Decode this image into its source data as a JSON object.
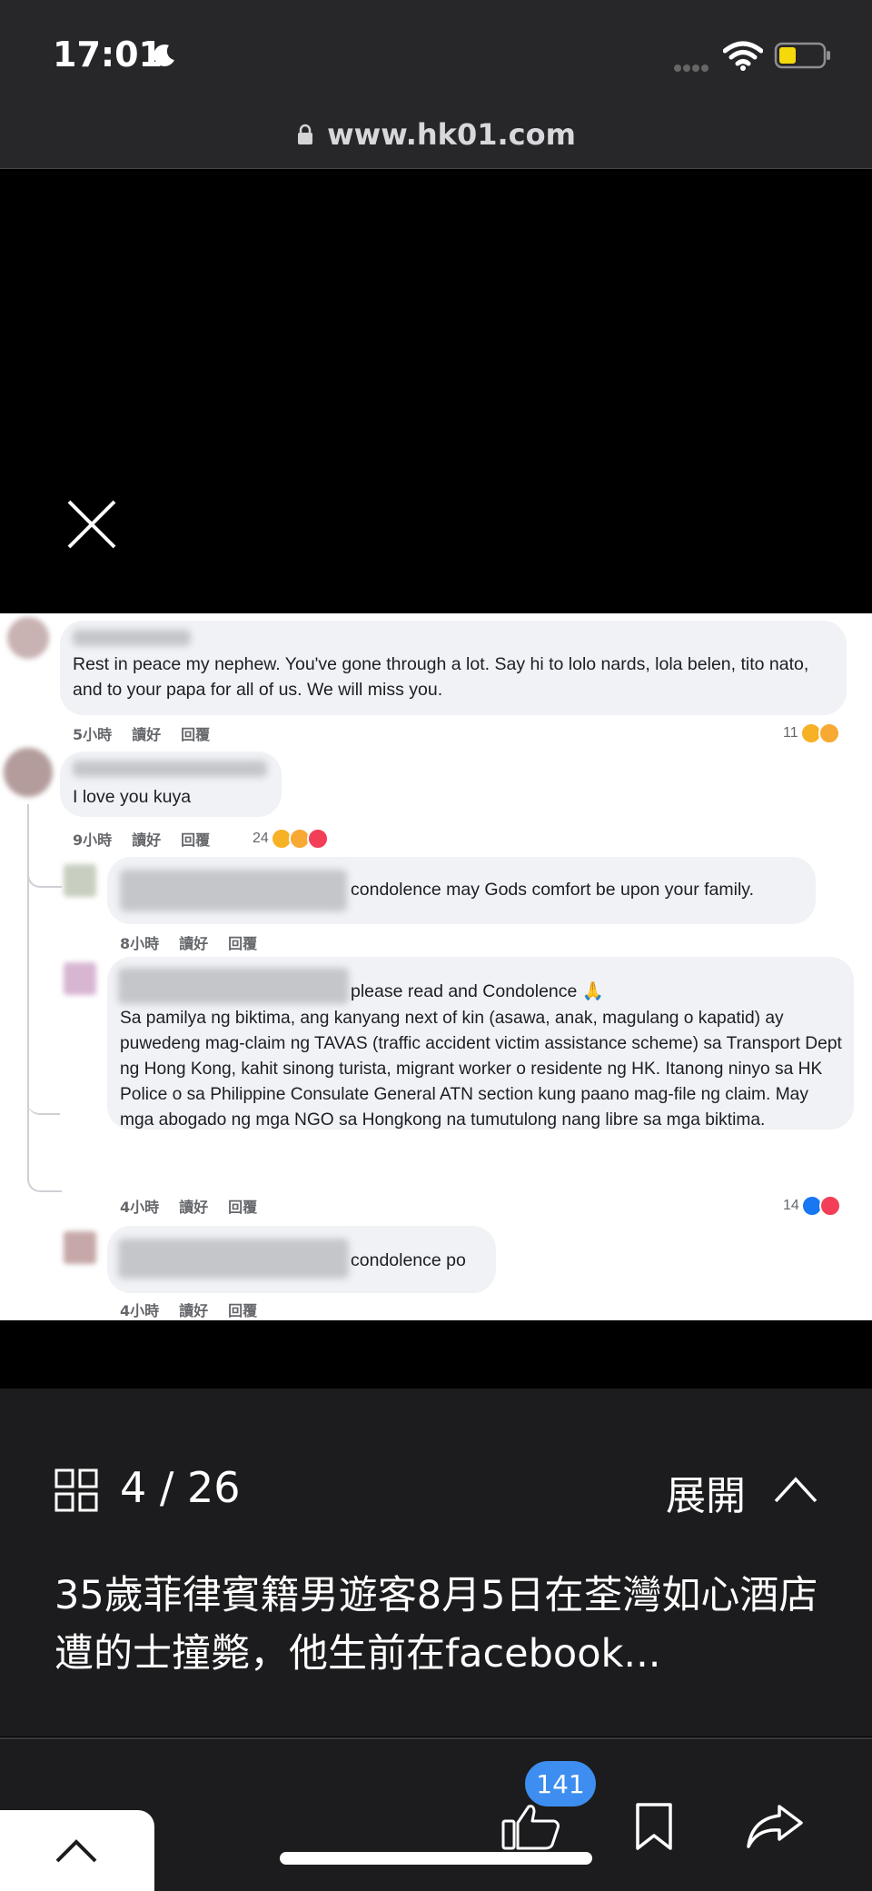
{
  "status_bar": {
    "time": "17:01"
  },
  "browser": {
    "url": "www.hk01.com"
  },
  "comments": [
    {
      "text": "Rest in peace my nephew. You've gone through a lot. Say hi to lolo nards, lola belen, tito nato, and to your papa for all of us. We will miss you.",
      "time": "5小時",
      "like": "讀好",
      "reply": "回覆",
      "reaction_count": "11"
    },
    {
      "text": "I love you kuya",
      "time": "9小時",
      "like": "讀好",
      "reply": "回覆",
      "reaction_count": "24"
    },
    {
      "text": "condolence may Gods comfort be upon your family.",
      "time": "8小時",
      "like": "讀好",
      "reply": "回覆"
    },
    {
      "intro": "please read and Condolence 🙏",
      "text": "Sa pamilya ng biktima, ang kanyang next of kin (asawa, anak, magulang o kapatid) ay puwedeng mag-claim ng TAVAS (traffic accident victim assistance scheme) sa Transport Dept ng Hong Kong, kahit sinong turista, migrant worker o residente ng HK. Itanong ninyo sa HK Police o sa Philippine Consulate General ATN section kung paano mag-file ng claim. May mga abogado ng mga NGO sa Hongkong na tumutulong nang libre sa mga biktima.",
      "time": "4小時",
      "like": "讀好",
      "reply": "回覆",
      "reaction_count": "14"
    },
    {
      "text": "condolence po",
      "time": "4小時",
      "like": "讀好",
      "reply": "回覆"
    }
  ],
  "gallery": {
    "counter": "4 / 26",
    "expand_label": "展開",
    "caption": "35歲菲律賓籍男遊客8月5日在荃灣如心酒店遭的士撞斃，他生前在facebook..."
  },
  "toolbar": {
    "like_count": "141"
  },
  "colors": {
    "badge": "#3d8ef0",
    "panel": "#1c1c1e",
    "status_bar": "#27272a"
  }
}
